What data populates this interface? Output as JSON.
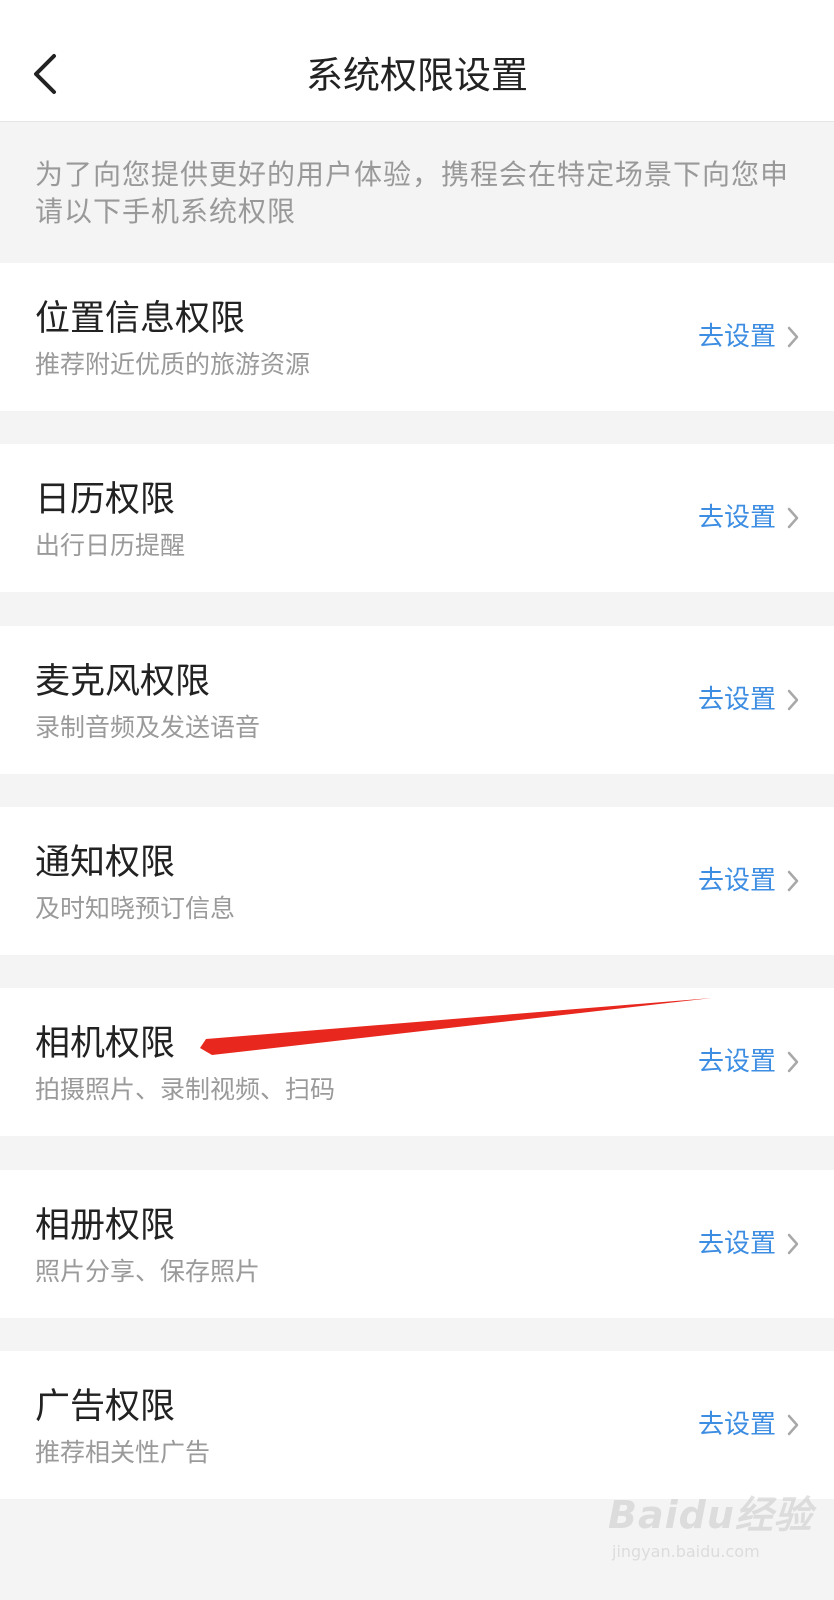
{
  "header": {
    "title": "系统权限设置",
    "back_icon": "chevron-left-icon"
  },
  "intro": "为了向您提供更好的用户体验，携程会在特定场景下向您申请以下手机系统权限",
  "colors": {
    "accent": "#3d8de2",
    "annotation_arrow": "#e8281e",
    "background": "#f4f4f4"
  },
  "permissions": [
    {
      "title": "位置信息权限",
      "desc": "推荐附近优质的旅游资源",
      "action": "去设置"
    },
    {
      "title": "日历权限",
      "desc": "出行日历提醒",
      "action": "去设置"
    },
    {
      "title": "麦克风权限",
      "desc": "录制音频及发送语音",
      "action": "去设置"
    },
    {
      "title": "通知权限",
      "desc": "及时知晓预订信息",
      "action": "去设置"
    },
    {
      "title": "相机权限",
      "desc": "拍摄照片、录制视频、扫码",
      "action": "去设置"
    },
    {
      "title": "相册权限",
      "desc": "照片分享、保存照片",
      "action": "去设置"
    },
    {
      "title": "广告权限",
      "desc": "推荐相关性广告",
      "action": "去设置"
    }
  ],
  "watermark": {
    "main": "Baidu经验",
    "sub": "jingyan.baidu.com"
  }
}
